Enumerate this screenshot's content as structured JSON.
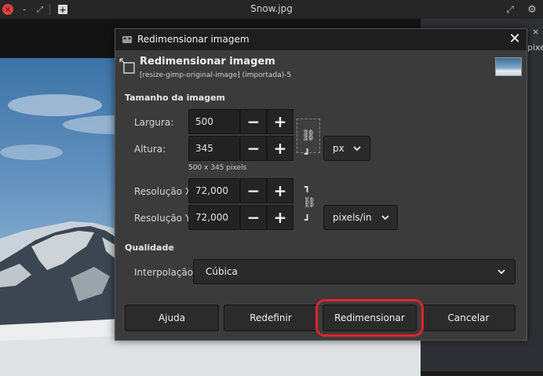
{
  "window": {
    "title": "Snow.jpg",
    "controls": {
      "close": "×",
      "minimize": "-",
      "restore": "⤢",
      "new_tab": "+",
      "expand": "⤢",
      "settings": "⚙"
    }
  },
  "right_panel": {
    "text": "pixels",
    "close": "×"
  },
  "dialog": {
    "title": "Redimensionar imagem",
    "header_title": "Redimensionar imagem",
    "header_subtitle": "[resize-gimp-original-image] (importada)-5",
    "sections": {
      "image_size": "Tamanho da imagem",
      "quality": "Qualidade"
    },
    "width": {
      "label": "Largura:",
      "value": "500"
    },
    "height": {
      "label": "Altura:",
      "value": "345"
    },
    "size_unit": "px",
    "size_note": "500 x 345 pixels",
    "res_x": {
      "label": "Resolução X:",
      "value": "72,000"
    },
    "res_y": {
      "label": "Resolução Y:",
      "value": "72,000"
    },
    "res_unit": "pixels/in",
    "interpolation": {
      "label": "Interpolação:",
      "value": "Cúbica"
    },
    "steppers": {
      "minus": "−",
      "plus": "+"
    },
    "buttons": {
      "help": "Ajuda",
      "reset": "Redefinir",
      "resize": "Redimensionar",
      "cancel": "Cancelar"
    },
    "close": "✕",
    "highlight_color": "#e0242a"
  }
}
